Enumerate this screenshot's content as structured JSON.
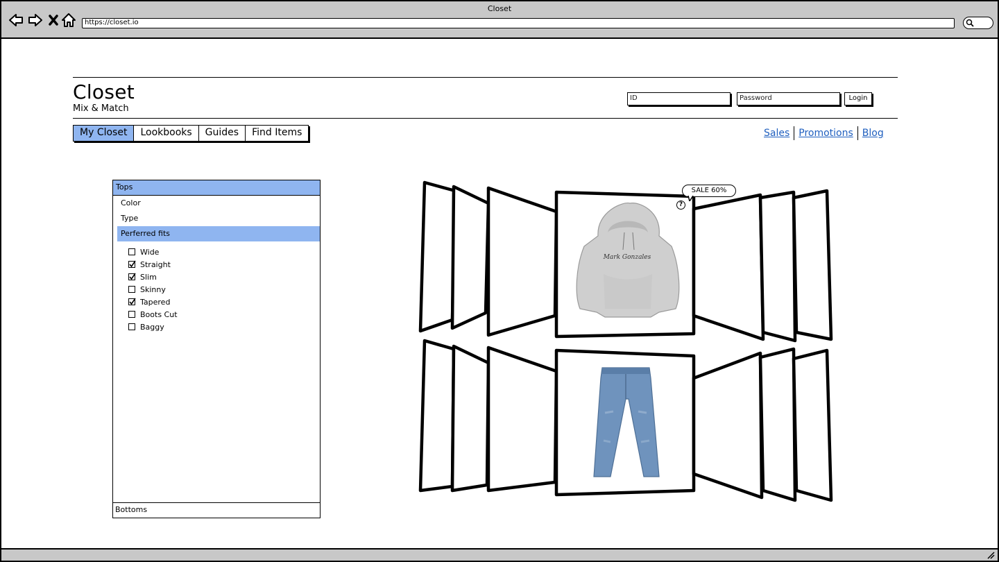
{
  "window": {
    "title": "Closet"
  },
  "browser": {
    "url": "https://closet.io"
  },
  "header": {
    "logo": "Closet",
    "tagline": "Mix & Match",
    "id_placeholder": "ID",
    "password_placeholder": "Password",
    "login_label": "Login"
  },
  "nav": {
    "tabs": [
      {
        "label": "My Closet",
        "active": true
      },
      {
        "label": "Lookbooks",
        "active": false
      },
      {
        "label": "Guides",
        "active": false
      },
      {
        "label": "Find Items",
        "active": false
      }
    ],
    "links": [
      "Sales",
      "Promotions",
      "Blog"
    ]
  },
  "filters": {
    "section": "Tops",
    "items": [
      "Color",
      "Type",
      "Perferred fits"
    ],
    "selected_item": "Perferred fits",
    "fits": [
      {
        "label": "Wide",
        "checked": false
      },
      {
        "label": "Straight",
        "checked": true
      },
      {
        "label": "Slim",
        "checked": true
      },
      {
        "label": "Skinny",
        "checked": false
      },
      {
        "label": "Tapered",
        "checked": true
      },
      {
        "label": "Boots Cut",
        "checked": false
      },
      {
        "label": "Baggy",
        "checked": false
      }
    ],
    "footer_section": "Bottoms"
  },
  "carousel": {
    "sale_badge": "SALE 60%",
    "help_glyph": "?",
    "hoodie_print": "Mark Gonzales",
    "items": [
      "hoodie",
      "jeans"
    ]
  },
  "colors": {
    "accent": "#8fb5f0",
    "link": "#1f5fbf",
    "chrome": "#c8c8c8"
  }
}
